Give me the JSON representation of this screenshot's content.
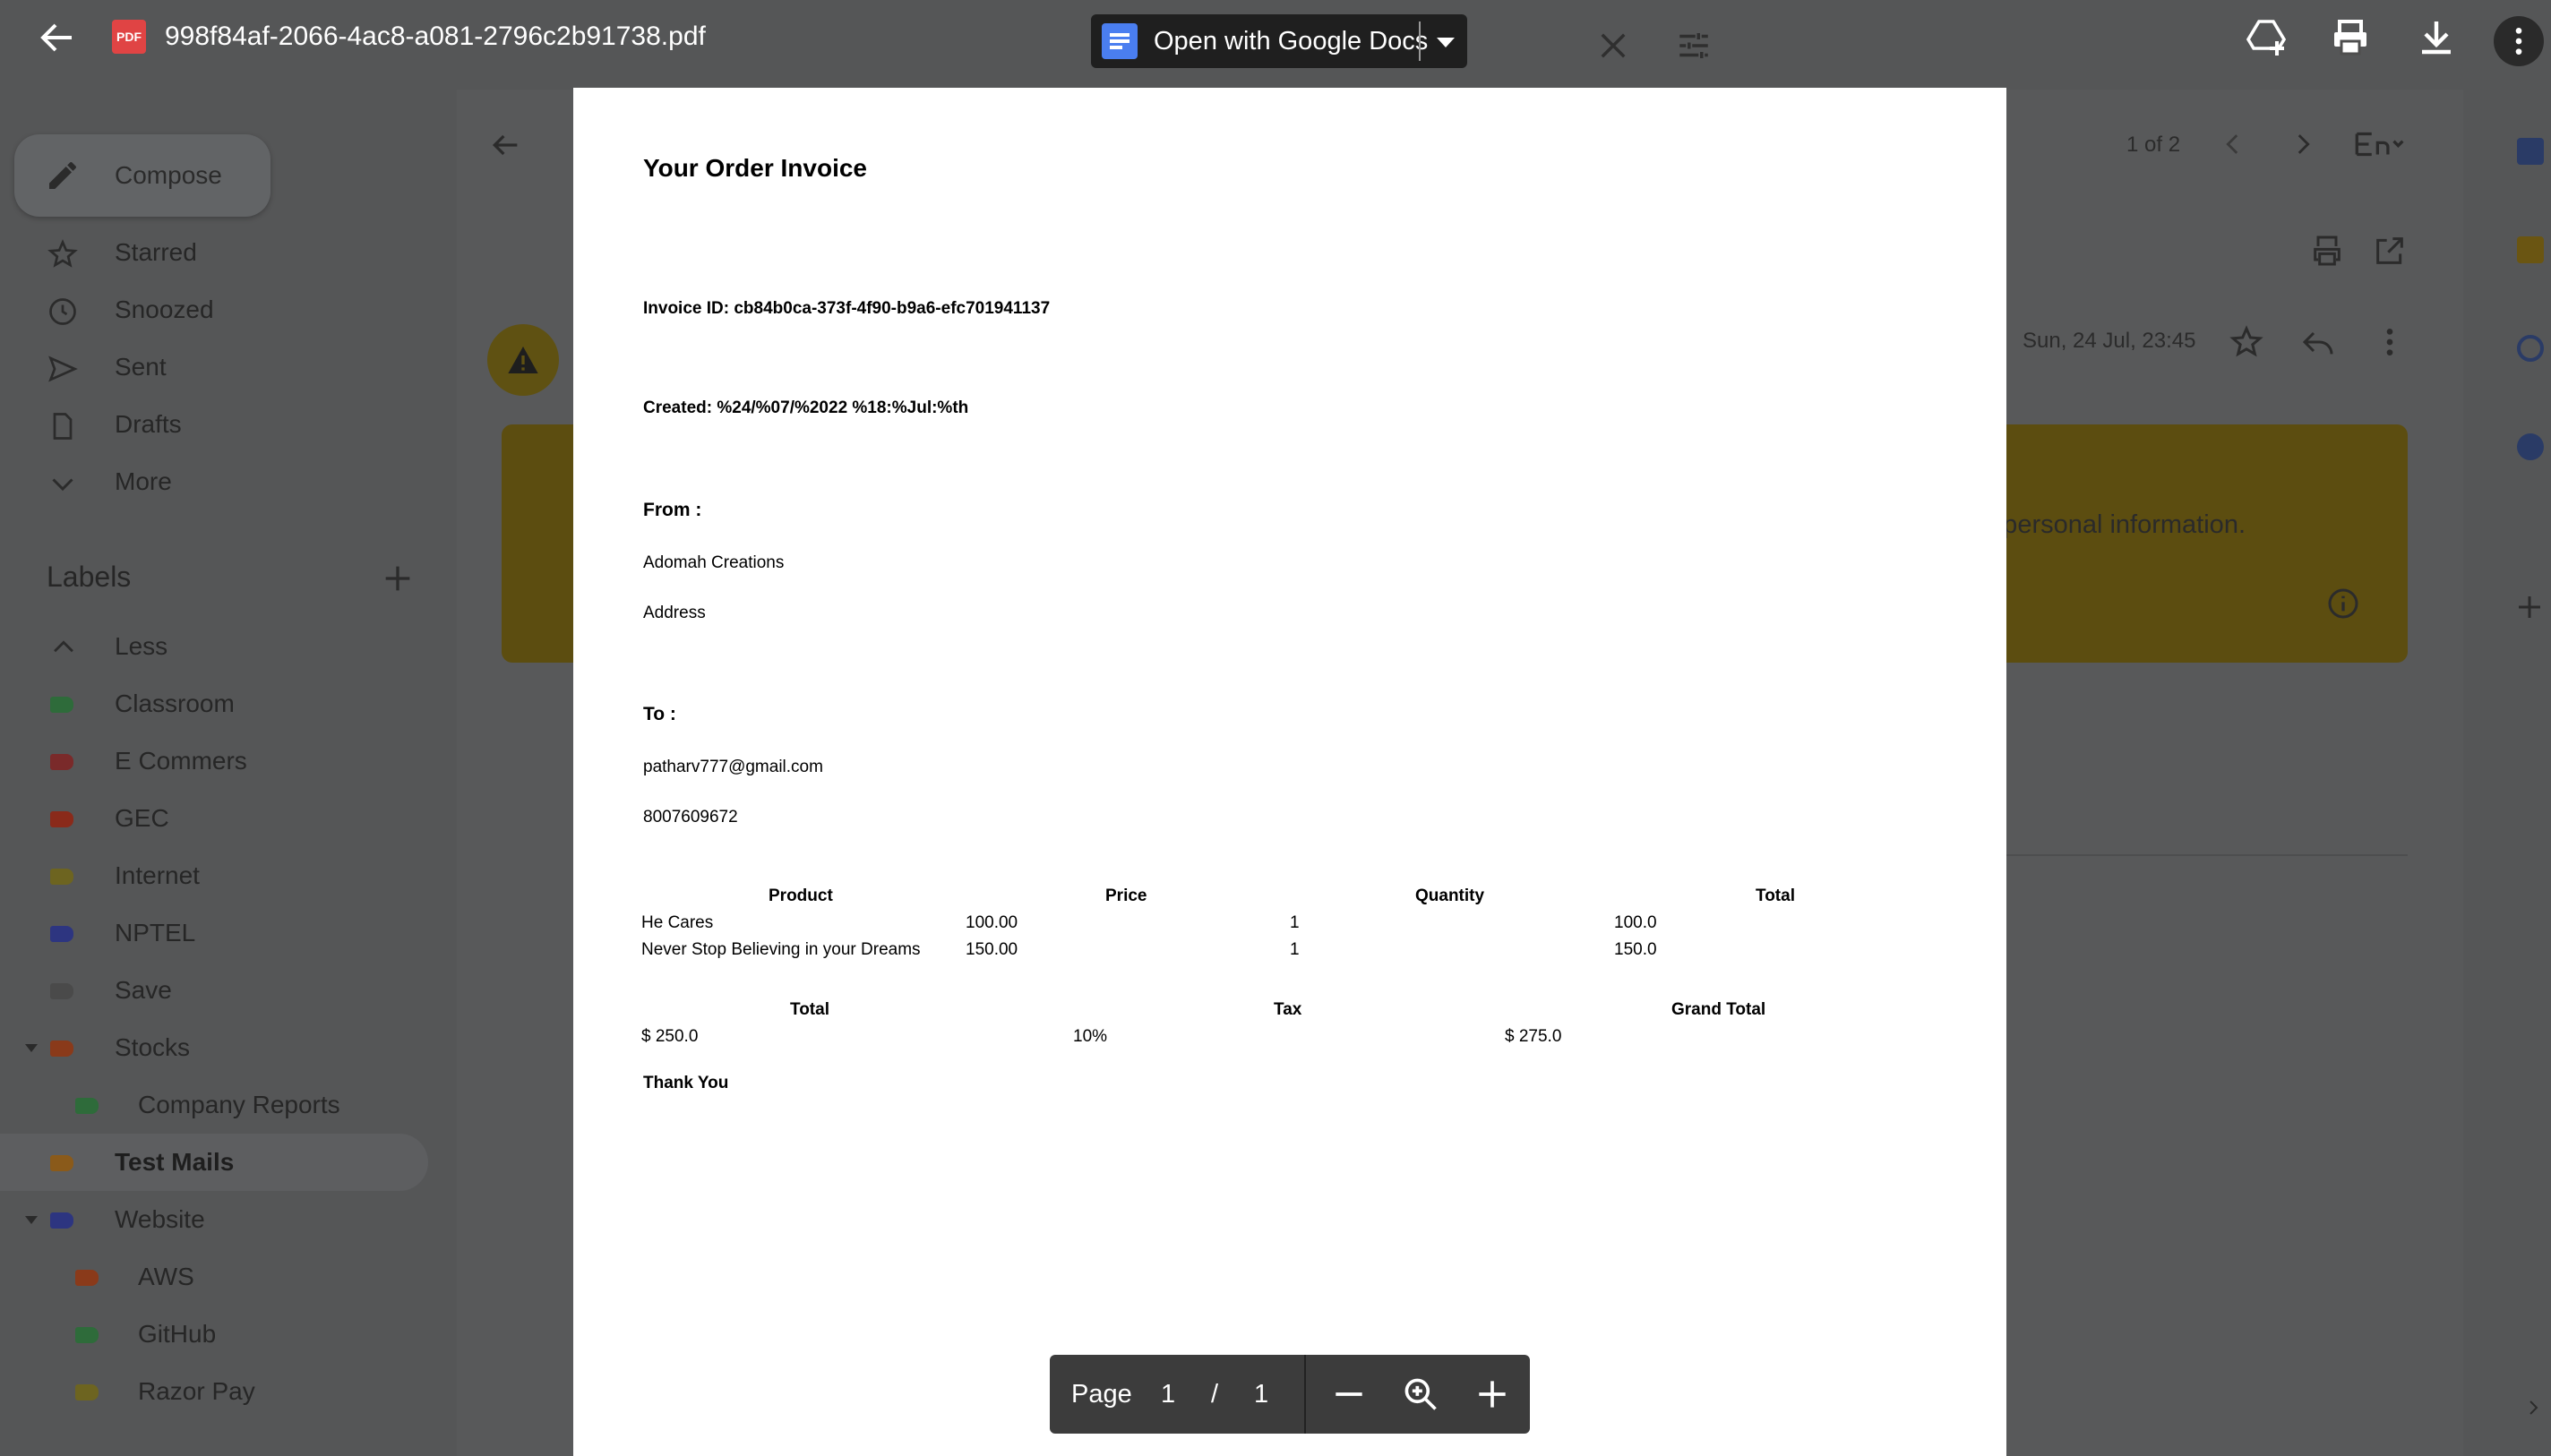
{
  "viewer": {
    "filename": "998f84af-2066-4ac8-a081-2796c2b91738.pdf",
    "file_badge": "PDF",
    "open_with": "Open with Google Docs",
    "page_label": "Page",
    "current_page": "1",
    "page_sep": "/",
    "total_pages": "1"
  },
  "gmail": {
    "compose": "Compose",
    "nav": [
      "Starred",
      "Snoozed",
      "Sent",
      "Drafts",
      "More"
    ],
    "labels_heading": "Labels",
    "labels": [
      {
        "name": "Less",
        "color": ""
      },
      {
        "name": "Classroom",
        "color": "#2e6b3a"
      },
      {
        "name": "E Commers",
        "color": "#7a2a2a"
      },
      {
        "name": "GEC",
        "color": "#8a2a1a"
      },
      {
        "name": "Internet",
        "color": "#6d6420"
      },
      {
        "name": "NPTEL",
        "color": "#2d3580"
      },
      {
        "name": "Save",
        "color": "#4a4a4a"
      },
      {
        "name": "Stocks",
        "color": "#8a3a1a"
      },
      {
        "name": "Company Reports",
        "color": "#2e6b3a"
      },
      {
        "name": "Test Mails",
        "color": "#8a5a1a"
      },
      {
        "name": "Website",
        "color": "#2d3580"
      },
      {
        "name": "AWS",
        "color": "#8a3a1a"
      },
      {
        "name": "GitHub",
        "color": "#2e6b3a"
      },
      {
        "name": "Razor Pay",
        "color": "#6d6420"
      }
    ],
    "message_date": "Sun, 24 Jul, 23:45",
    "pagination": "1 of 2",
    "banner_text": "h personal information."
  },
  "invoice": {
    "title": "Your Order Invoice",
    "invoice_id": "Invoice ID: cb84b0ca-373f-4f90-b9a6-efc701941137",
    "created": "Created: %24/%07/%2022 %18:%Jul:%th",
    "from_label": "From :",
    "from_name": "Adomah Creations",
    "from_address": "Address",
    "to_label": "To :",
    "to_email": "patharv777@gmail.com",
    "to_phone": "8007609672",
    "table_headers": [
      "Product",
      "Price",
      "Quantity",
      "Total"
    ],
    "rows": [
      [
        "He Cares",
        "100.00",
        "1",
        "100.0"
      ],
      [
        "Never Stop Believing in your Dreams",
        "150.00",
        "1",
        "150.0"
      ]
    ],
    "summary_headers": [
      "Total",
      "Tax",
      "Grand Total"
    ],
    "summary_values": [
      "$ 250.0",
      "10%",
      "$ 275.0"
    ],
    "thanks": "Thank You"
  },
  "colors": {
    "topbar_text": "#ffffff",
    "page_bg": "#ffffff",
    "overlay_bg": "#555657",
    "docs_blue": "#4a7ef0",
    "pdf_red": "#e04444"
  }
}
